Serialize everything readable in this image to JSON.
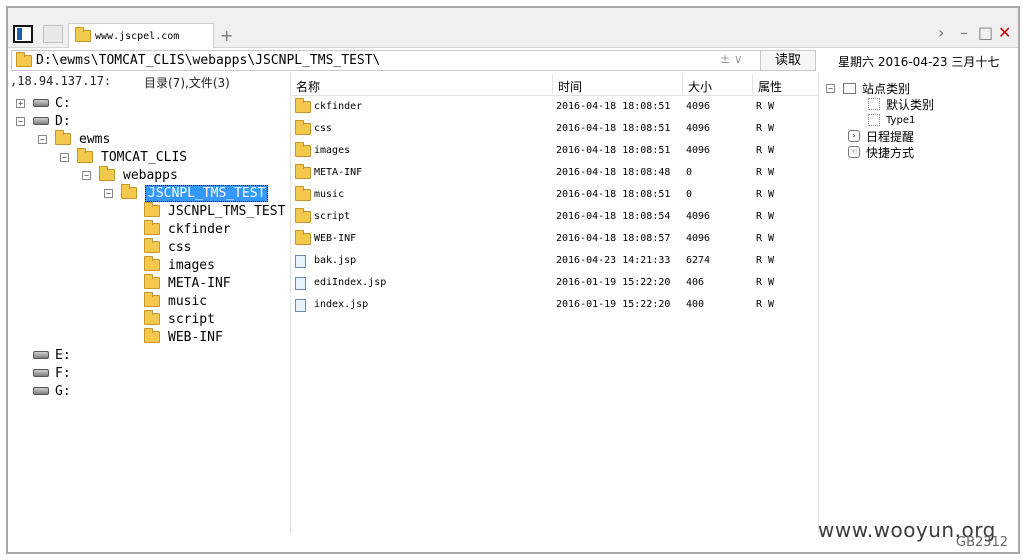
{
  "tab": {
    "title": "www.jscpel.com",
    "new_tab": "+"
  },
  "window_controls": {
    "forward": "›",
    "minimize": "–",
    "maximize": "□",
    "close": "✕"
  },
  "address": {
    "path": "D:\\ewms\\TOMCAT_CLIS\\webapps\\JSCNPL_TMS_TEST\\",
    "controls": "± ∨",
    "read_label": "读取"
  },
  "date_text": "星期六 2016-04-23 三月十七",
  "status": {
    "ip": ",18.94.137.17:",
    "dir_count": "目录(7),文件(3)"
  },
  "tree": {
    "drives": [
      "C:",
      "D:",
      "E:",
      "F:",
      "G:"
    ],
    "ewms": "ewms",
    "tomcat": "TOMCAT_CLIS",
    "webapps": "webapps",
    "selected": "JSCNPL_TMS_TEST",
    "children": [
      "JSCNPL_TMS_TEST",
      "ckfinder",
      "css",
      "images",
      "META-INF",
      "music",
      "script",
      "WEB-INF"
    ]
  },
  "columns": {
    "name": "名称",
    "time": "时间",
    "size": "大小",
    "attr": "属性"
  },
  "files": [
    {
      "type": "folder",
      "name": "ckfinder",
      "time": "2016-04-18 18:08:51",
      "size": "4096",
      "attr": "R W"
    },
    {
      "type": "folder",
      "name": "css",
      "time": "2016-04-18 18:08:51",
      "size": "4096",
      "attr": "R W"
    },
    {
      "type": "folder",
      "name": "images",
      "time": "2016-04-18 18:08:51",
      "size": "4096",
      "attr": "R W"
    },
    {
      "type": "folder",
      "name": "META-INF",
      "time": "2016-04-18 18:08:48",
      "size": "0",
      "attr": "R W"
    },
    {
      "type": "folder",
      "name": "music",
      "time": "2016-04-18 18:08:51",
      "size": "0",
      "attr": "R W"
    },
    {
      "type": "folder",
      "name": "script",
      "time": "2016-04-18 18:08:54",
      "size": "4096",
      "attr": "R W"
    },
    {
      "type": "folder",
      "name": "WEB-INF",
      "time": "2016-04-18 18:08:57",
      "size": "4096",
      "attr": "R W"
    },
    {
      "type": "file",
      "name": "bak.jsp",
      "time": "2016-04-23 14:21:33",
      "size": "6274",
      "attr": "R W"
    },
    {
      "type": "file",
      "name": "ediIndex.jsp",
      "time": "2016-01-19 15:22:20",
      "size": "406",
      "attr": "R W"
    },
    {
      "type": "file",
      "name": "index.jsp",
      "time": "2016-01-19 15:22:20",
      "size": "400",
      "attr": "R W"
    }
  ],
  "side_panel": {
    "site_category": "站点类别",
    "default_category": "默认类别",
    "type1": "Type1",
    "schedule": "日程提醒",
    "shortcuts": "快捷方式"
  },
  "watermark": "www.wooyun.org",
  "encoding": "GB2312"
}
